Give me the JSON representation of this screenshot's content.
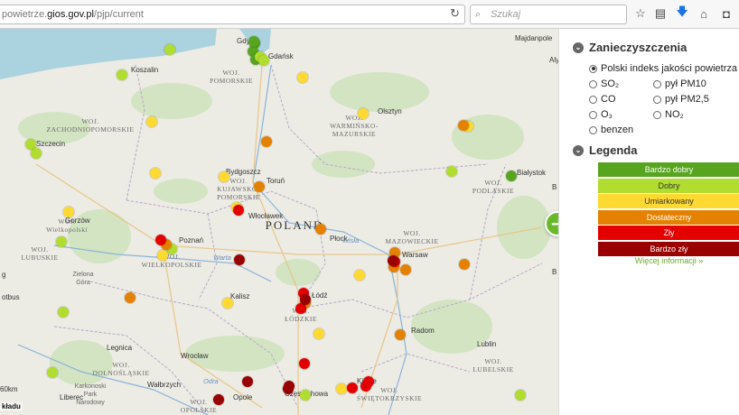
{
  "browser": {
    "url_prefix": "powietrze.",
    "url_domain": "gios.gov.pl",
    "url_path": "/pjp/current",
    "search_placeholder": "Szukaj",
    "reload_icon": "reload-icon",
    "search_icon": "magnifier-icon",
    "toolbar_icons": [
      "bookmark-star-icon",
      "reading-list-icon",
      "download-arrow-icon",
      "home-icon",
      "pocket-icon"
    ]
  },
  "map": {
    "country_label": "POLAND",
    "voivodeships": [
      {
        "name": "WOJ.\nPOMORSKIE"
      },
      {
        "name": "WOJ.\nZACHODNIOPOMORSKIE"
      },
      {
        "name": "WOJ.\nWARMIŃSKO-\nMAZURSKIE"
      },
      {
        "name": "WOJ.\nKUJAWSKO-\nPOMORSKIE"
      },
      {
        "name": "WOJ.\nPODLASKIE"
      },
      {
        "name": "WOJ.\nWielkopolski"
      },
      {
        "name": "WOJ.\nLUBUSKIE"
      },
      {
        "name": "WOJ.\nWIELKOPOLSKIE"
      },
      {
        "name": "WOJ.\nMAZOWIECKIE"
      },
      {
        "name": "WOJ.\nŁÓDZKIE"
      },
      {
        "name": "WOJ.\nLUBELSKIE"
      },
      {
        "name": "WOJ.\nDOLNOŚLĄSKIE"
      },
      {
        "name": "WOJ.\nOPOLSKIE"
      },
      {
        "name": "WOJ.\nŚWIĘTOKRZYSKIE"
      }
    ],
    "cities": [
      "Gdynia",
      "Gdańsk",
      "Koszalin",
      "Olsztyn",
      "Szczecin",
      "Bydgoszcz",
      "Toruń",
      "Białystok",
      "Włocławek",
      "Gorzów",
      "Poznań",
      "Płock",
      "Warsaw",
      "Zielona\nGóra",
      "Kalisz",
      "Łódź",
      "Radom",
      "Legnica",
      "Wrocław",
      "Lublin",
      "Wałbrzych",
      "Opole",
      "Częstochowa",
      "Kielce",
      "Liberec",
      "Karkonoski\nPark\nNarodowy",
      "Majdanpole",
      "Alytu",
      "B",
      "B",
      "g",
      "otbus"
    ],
    "rivers": [
      "Wisła",
      "Warta",
      "Odra"
    ],
    "scale_text": "60km",
    "attribution": "kładu",
    "stations": [
      {
        "level": "good"
      },
      {
        "level": "good"
      },
      {
        "level": "good"
      },
      {
        "level": "good"
      },
      {
        "level": "good"
      },
      {
        "level": "dobry"
      },
      {
        "level": "dobry"
      },
      {
        "level": "dobry"
      },
      {
        "level": "dobry"
      },
      {
        "level": "dobry"
      },
      {
        "level": "dobry"
      },
      {
        "level": "dobry"
      },
      {
        "level": "dobry"
      },
      {
        "level": "dobry"
      },
      {
        "level": "dobry"
      },
      {
        "level": "dobry"
      },
      {
        "level": "dobry"
      },
      {
        "level": "dobry"
      },
      {
        "level": "moderate"
      },
      {
        "level": "moderate"
      },
      {
        "level": "moderate"
      },
      {
        "level": "moderate"
      },
      {
        "level": "moderate"
      },
      {
        "level": "moderate"
      },
      {
        "level": "moderate"
      },
      {
        "level": "moderate"
      },
      {
        "level": "moderate"
      },
      {
        "level": "moderate"
      },
      {
        "level": "moderate"
      },
      {
        "level": "moderate"
      },
      {
        "level": "moderate"
      },
      {
        "level": "sufficient"
      },
      {
        "level": "sufficient"
      },
      {
        "level": "sufficient"
      },
      {
        "level": "sufficient"
      },
      {
        "level": "sufficient"
      },
      {
        "level": "sufficient"
      },
      {
        "level": "sufficient"
      },
      {
        "level": "sufficient"
      },
      {
        "level": "sufficient"
      },
      {
        "level": "sufficient"
      },
      {
        "level": "sufficient"
      },
      {
        "level": "sufficient"
      },
      {
        "level": "bad"
      },
      {
        "level": "bad"
      },
      {
        "level": "bad"
      },
      {
        "level": "bad"
      },
      {
        "level": "bad"
      },
      {
        "level": "bad"
      },
      {
        "level": "bad"
      },
      {
        "level": "bad"
      },
      {
        "level": "bad"
      },
      {
        "level": "verybad"
      },
      {
        "level": "verybad"
      },
      {
        "level": "verybad"
      },
      {
        "level": "verybad"
      },
      {
        "level": "verybad"
      },
      {
        "level": "verybad"
      },
      {
        "level": "verybad"
      }
    ]
  },
  "next_button_icon": "arrow-right-icon",
  "panel": {
    "pollution_title": "Zanieczyszczenia",
    "options": [
      {
        "label": "Polski indeks jakości powietrza",
        "selected": true
      },
      {
        "label": "SO₂",
        "selected": false
      },
      {
        "label": "pył PM10",
        "selected": false
      },
      {
        "label": "CO",
        "selected": false
      },
      {
        "label": "pył PM2,5",
        "selected": false
      },
      {
        "label": "O₃",
        "selected": false
      },
      {
        "label": "NO₂",
        "selected": false
      },
      {
        "label": "benzen",
        "selected": false
      }
    ],
    "legend_title": "Legenda",
    "legend": [
      {
        "label": "Bardzo dobry",
        "color": "#57a51e",
        "text_color": "#ffffff"
      },
      {
        "label": "Dobry",
        "color": "#b0dd2f",
        "text_color": "#333333"
      },
      {
        "label": "Umiarkowany",
        "color": "#fed931",
        "text_color": "#333333"
      },
      {
        "label": "Dostateczny",
        "color": "#e58100",
        "text_color": "#ffffff"
      },
      {
        "label": "Zły",
        "color": "#e50000",
        "text_color": "#ffffff"
      },
      {
        "label": "Bardzo zły",
        "color": "#990000",
        "text_color": "#ffffff"
      }
    ],
    "more_link": "Więcej informacji »"
  },
  "station_colors": {
    "good": "#57a51e",
    "dobry": "#b0dd2f",
    "moderate": "#fed931",
    "sufficient": "#e58100",
    "bad": "#e50000",
    "verybad": "#990000"
  }
}
